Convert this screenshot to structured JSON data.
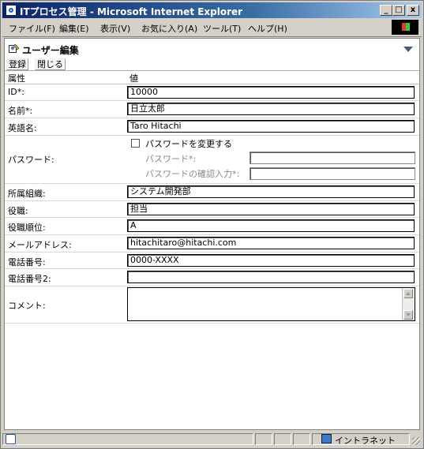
{
  "window": {
    "title": "ITプロセス管理 - Microsoft Internet Explorer",
    "minimize": "_",
    "maximize": "□",
    "close": "x"
  },
  "menu": [
    "ファイル(F)",
    "編集(E)",
    "表示(V)",
    "お気に入り(A)",
    "ツール(T)",
    "ヘルプ(H)"
  ],
  "page": {
    "title": "ユーザー編集",
    "buttons": {
      "register": "登録",
      "close": "閉じる"
    },
    "columns": {
      "attribute": "属性",
      "value": "値"
    }
  },
  "form": {
    "id": {
      "label": "ID*:",
      "value": "10000"
    },
    "name": {
      "label": "名前*:",
      "value": "日立太郎"
    },
    "english_name": {
      "label": "英語名:",
      "value": "Taro Hitachi"
    },
    "password": {
      "label": "パスワード:",
      "change_label": "パスワードを変更する",
      "change_checked": false,
      "password_label": "パスワード*:",
      "confirm_label": "パスワードの確認入力*:",
      "password_value": "",
      "confirm_value": ""
    },
    "organization": {
      "label": "所属組織:",
      "value": "システム開発部"
    },
    "position": {
      "label": "役職:",
      "value": "担当"
    },
    "position_rank": {
      "label": "役職順位:",
      "value": "A"
    },
    "email": {
      "label": "メールアドレス:",
      "value": "hitachitaro@hitachi.com"
    },
    "phone": {
      "label": "電話番号:",
      "value": "0000-XXXX"
    },
    "phone2": {
      "label": "電話番号2:",
      "value": ""
    },
    "comment": {
      "label": "コメント:",
      "value": ""
    }
  },
  "status": {
    "zone": "イントラネット"
  }
}
